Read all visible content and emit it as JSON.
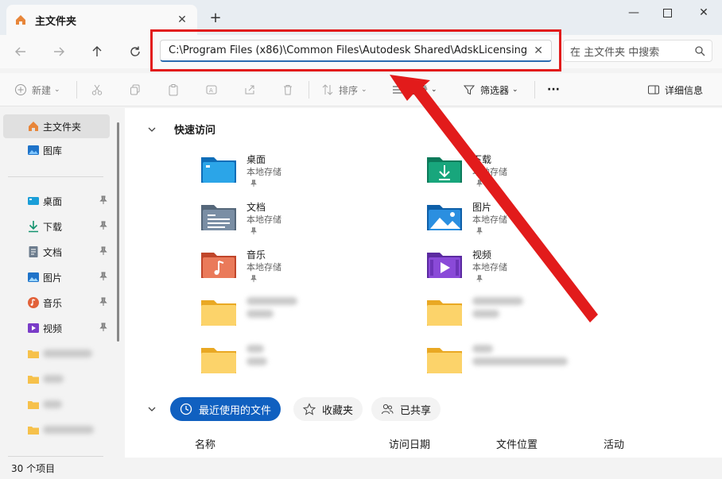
{
  "tabs": [
    {
      "label": "主文件夹"
    }
  ],
  "address": {
    "path": "C:\\Program Files (x86)\\Common Files\\Autodesk Shared\\AdskLicensing"
  },
  "search": {
    "placeholder": "在 主文件夹 中搜索"
  },
  "toolbar": {
    "new_label": "新建",
    "sort_label": "排序",
    "view_label": "查看",
    "filter_label": "筛选器",
    "more_label": "···",
    "details_label": "详细信息"
  },
  "sidebar": {
    "top": [
      {
        "label": "主文件夹",
        "icon": "home-icon"
      },
      {
        "label": "图库",
        "icon": "gallery-icon"
      }
    ],
    "pinned": [
      {
        "label": "桌面",
        "icon": "desktop-icon"
      },
      {
        "label": "下载",
        "icon": "download-icon"
      },
      {
        "label": "文档",
        "icon": "document-icon"
      },
      {
        "label": "图片",
        "icon": "pictures-icon"
      },
      {
        "label": "音乐",
        "icon": "music-icon"
      },
      {
        "label": "视频",
        "icon": "video-icon"
      }
    ]
  },
  "quick_access": {
    "title": "快速访问",
    "items": [
      {
        "name": "桌面",
        "sub": "本地存储"
      },
      {
        "name": "下载",
        "sub": "本地存储"
      },
      {
        "name": "文档",
        "sub": "本地存储"
      },
      {
        "name": "图片",
        "sub": "本地存储"
      },
      {
        "name": "音乐",
        "sub": "本地存储"
      },
      {
        "name": "视频",
        "sub": "本地存储"
      }
    ]
  },
  "recent": {
    "tabs": [
      {
        "label": "最近使用的文件"
      },
      {
        "label": "收藏夹"
      },
      {
        "label": "已共享"
      }
    ],
    "columns": [
      "名称",
      "访问日期",
      "文件位置",
      "活动"
    ]
  },
  "status": {
    "count": "30 个项目"
  },
  "colors": {
    "accent": "#1060c0",
    "highlight": "#e21b1b"
  }
}
